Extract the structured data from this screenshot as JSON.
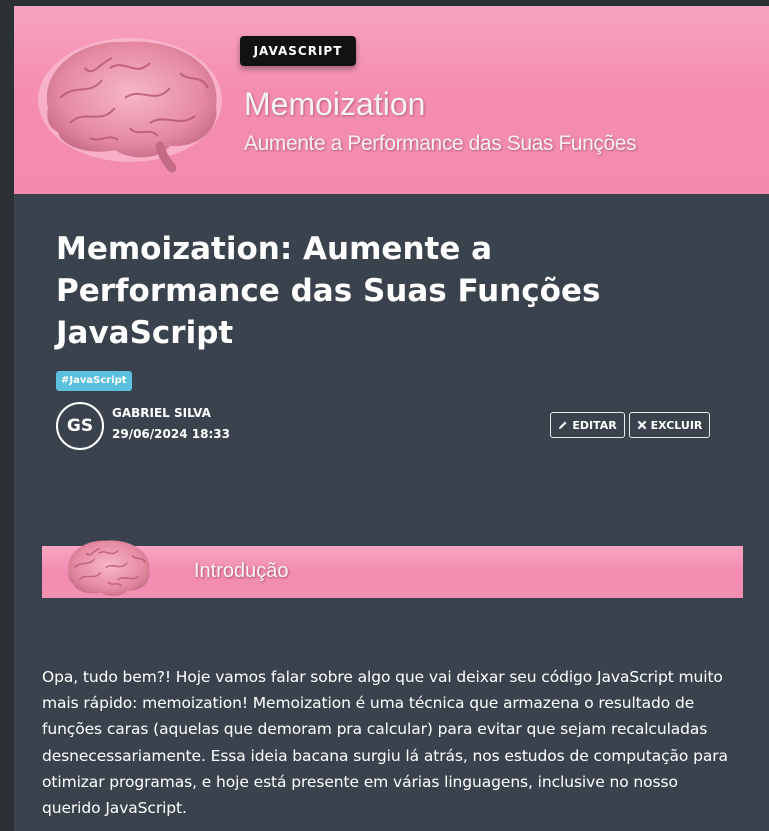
{
  "banner": {
    "tag": "JAVASCRIPT",
    "title": "Memoization",
    "subtitle": "Aumente a Performance das Suas Funções"
  },
  "post": {
    "title": "Memoization: Aumente a Performance das Suas Funções JavaScript",
    "hashtag": "#JavaScript",
    "author_initials": "GS",
    "author_name": "GABRIEL SILVA",
    "date": "29/06/2024 18:33",
    "edit_label": "EDITAR",
    "delete_label": "EXCLUIR"
  },
  "section": {
    "title": "Introdução",
    "paragraph": "Opa, tudo bem?! Hoje vamos falar sobre algo que vai deixar seu código JavaScript muito mais rápido: memoization! Memoization é uma técnica que armazena o resultado de funções caras (aquelas que demoram pra calcular) para evitar que sejam recalculadas desnecessariamente. Essa ideia bacana surgiu lá atrás, nos estudos de computação para otimizar programas, e hoje está presente em várias linguagens, inclusive no nosso querido JavaScript."
  },
  "icons": {
    "banner_image": "brain-icon",
    "edit": "pencil-icon",
    "delete": "close-icon"
  },
  "colors": {
    "banner_pink": "#f48db1",
    "page_background": "#3a434d",
    "hashtag_badge": "#5bc0de",
    "tag_pill": "#121212"
  }
}
